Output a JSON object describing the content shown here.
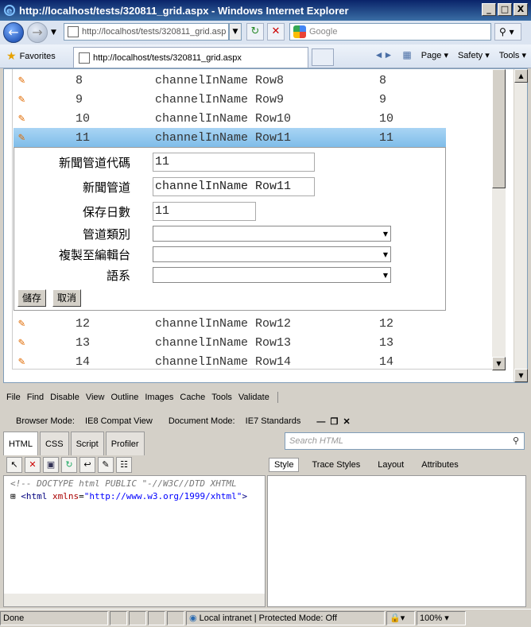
{
  "window": {
    "title": "http://localhost/tests/320811_grid.aspx - Windows Internet Explorer",
    "controls": [
      "_",
      "□",
      "X"
    ]
  },
  "nav": {
    "address": "http://localhost/tests/320811_grid.asp",
    "search_placeholder": "Google"
  },
  "favbar": {
    "favorites_label": "Favorites",
    "tab_title": "http://localhost/tests/320811_grid.aspx",
    "page_menu": "Page",
    "safety_menu": "Safety",
    "tools_menu": "Tools"
  },
  "grid": {
    "rows_before": [
      {
        "id": "8",
        "name": "channelInName Row8",
        "days": "8"
      },
      {
        "id": "9",
        "name": "channelInName Row9",
        "days": "9"
      },
      {
        "id": "10",
        "name": "channelInName Row10",
        "days": "10"
      }
    ],
    "selected_row": {
      "id": "11",
      "name": "channelInName Row11",
      "days": "11"
    },
    "rows_after": [
      {
        "id": "12",
        "name": "channelInName Row12",
        "days": "12"
      },
      {
        "id": "13",
        "name": "channelInName Row13",
        "days": "13"
      },
      {
        "id": "14",
        "name": "channelInName Row14",
        "days": "14"
      }
    ]
  },
  "edit_form": {
    "code_label": "新聞管道代碼",
    "code_value": "11",
    "name_label": "新聞管道",
    "name_value": "channelInName Row11",
    "days_label": "保存日數",
    "days_value": "11",
    "type_label": "管道類別",
    "copy_label": "複製至編輯台",
    "lang_label": "語系",
    "save_button": "儲存",
    "cancel_button": "取消"
  },
  "devtools": {
    "menu": [
      "File",
      "Find",
      "Disable",
      "View",
      "Outline",
      "Images",
      "Cache",
      "Tools",
      "Validate"
    ],
    "browser_mode_label": "Browser Mode:",
    "browser_mode_value": "IE8 Compat View",
    "document_mode_label": "Document Mode:",
    "document_mode_value": "IE7 Standards",
    "tabs": [
      "HTML",
      "CSS",
      "Script",
      "Profiler"
    ],
    "search_placeholder": "Search HTML",
    "right_tabs": [
      "Style",
      "Trace Styles",
      "Layout",
      "Attributes"
    ],
    "dom_doctype": "<!-- DOCTYPE html PUBLIC \"-//W3C//DTD XHTML",
    "dom_html_tag": "html",
    "dom_html_attr": "xmlns",
    "dom_html_val": "\"http://www.w3.org/1999/xhtml\""
  },
  "status": {
    "left": "Done",
    "zone": "Local intranet | Protected Mode: Off",
    "zoom": "100%"
  }
}
